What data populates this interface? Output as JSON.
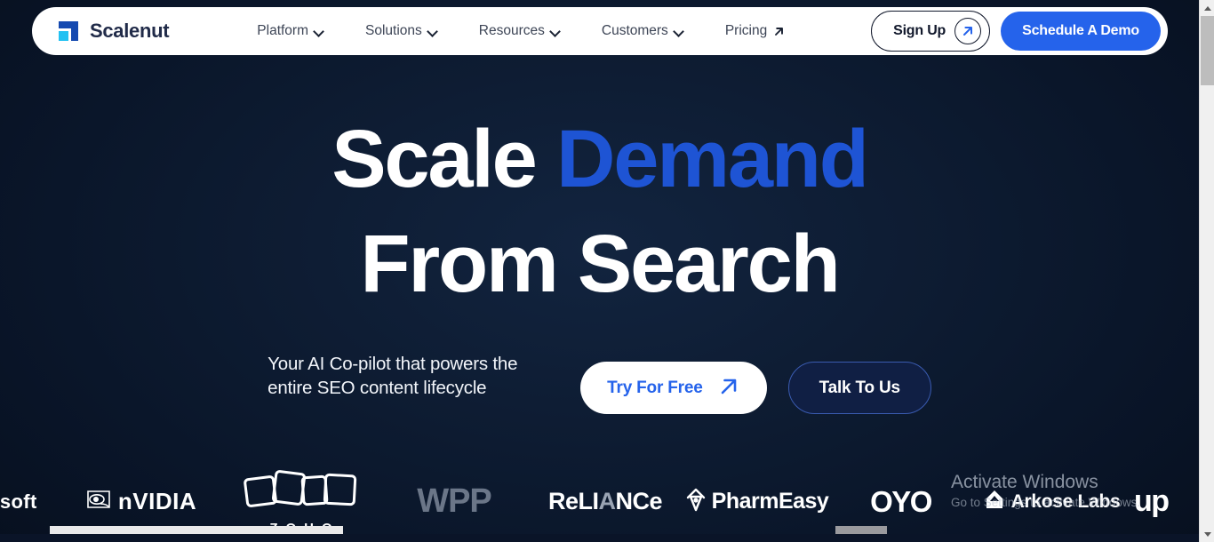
{
  "nav": {
    "brand": {
      "name": "Scalenut",
      "logo_icon": "scalenut-logo-icon"
    },
    "links": [
      {
        "label": "Platform",
        "icon": "chevron-down-icon",
        "has_dropdown": true
      },
      {
        "label": "Solutions",
        "icon": "chevron-down-icon",
        "has_dropdown": true
      },
      {
        "label": "Resources",
        "icon": "chevron-down-icon",
        "has_dropdown": true
      },
      {
        "label": "Customers",
        "icon": "chevron-down-icon",
        "has_dropdown": true
      },
      {
        "label": "Pricing",
        "icon": "external-link-arrow-icon",
        "has_dropdown": false
      }
    ],
    "sign_up": {
      "label": "Sign Up",
      "icon": "arrow-up-right-icon"
    },
    "demo": {
      "label": "Schedule A Demo"
    }
  },
  "hero": {
    "headline_line1_white": "Scale",
    "headline_line1_accent": "Demand",
    "headline_line2": "From Search",
    "subhead": "Your AI Co-pilot that powers the entire SEO content lifecycle",
    "cta_primary": {
      "label": "Try For Free",
      "icon": "arrow-up-right-icon"
    },
    "cta_secondary": {
      "label": "Talk To Us"
    }
  },
  "logos": {
    "items": [
      {
        "name": "microsoft",
        "text": "osoft",
        "style": "text",
        "clipped": true
      },
      {
        "name": "nvidia",
        "text": "nVIDIA",
        "style": "nvidia"
      },
      {
        "name": "zoho",
        "text": "ZOHO",
        "style": "zoho"
      },
      {
        "name": "wpp",
        "text": "WPP",
        "style": "wpp"
      },
      {
        "name": "reliance",
        "text": "ReLI",
        "text2": "A",
        "text3": "NCe",
        "style": "reliance"
      },
      {
        "name": "pharmeasy",
        "text": "PharmEasy",
        "style": "pharmeasy"
      },
      {
        "name": "oyo",
        "text": "OYO",
        "style": "oyo"
      },
      {
        "name": "arkose-labs",
        "text": "Arkose Labs",
        "style": "arkose"
      },
      {
        "name": "upwork",
        "text": "up",
        "style": "upwork",
        "clipped": true
      }
    ]
  },
  "watermark": {
    "line1": "Activate Windows",
    "line2": "Go to Settings to activate Windows."
  },
  "colors": {
    "brand_blue": "#2563eb",
    "accent_headline": "#1e54d4",
    "background": "#0a1428",
    "nav_bg": "#ffffff",
    "logo_cyan": "#22c1f2",
    "logo_navy": "#1449b0"
  }
}
